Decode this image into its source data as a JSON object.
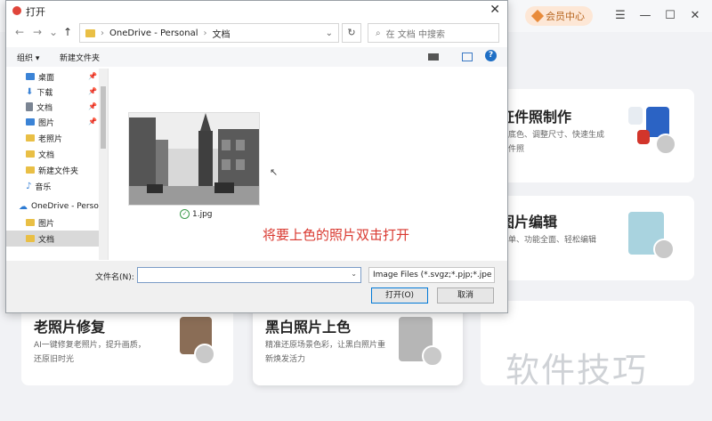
{
  "app": {
    "vip_label": "会员中心",
    "cards": [
      {
        "title": "证件照制作",
        "desc": "换底色、调整尺寸、快速生成证件照"
      },
      {
        "title": "图片编辑",
        "desc": "简单、功能全面、轻松编辑"
      },
      {
        "title": "老照片修复",
        "desc": "AI一键修复老照片，提升画质，还原旧时光"
      },
      {
        "title": "黑白照片上色",
        "desc": "精准还原场景色彩，让黑白照片重新焕发活力"
      }
    ],
    "watermark": "软件技巧"
  },
  "dialog": {
    "title": "打开",
    "address": {
      "root": "OneDrive - Personal",
      "folder": "文档"
    },
    "search_placeholder": "在 文档 中搜索",
    "toolbar": {
      "organize": "组织 ▾",
      "new_folder": "新建文件夹"
    },
    "sidebar": [
      {
        "label": "桌面",
        "icon": "desktop-icon",
        "color": "#3b83d6"
      },
      {
        "label": "下载",
        "icon": "download-icon",
        "color": "#3b83d6"
      },
      {
        "label": "文档",
        "icon": "document-icon",
        "color": "#7b8593"
      },
      {
        "label": "图片",
        "icon": "picture-icon",
        "color": "#3b83d6"
      },
      {
        "label": "老照片",
        "icon": "folder-icon",
        "color": "#e9bf45"
      },
      {
        "label": "文档",
        "icon": "folder-icon",
        "color": "#e9bf45"
      },
      {
        "label": "新建文件夹",
        "icon": "folder-icon",
        "color": "#e9bf45"
      },
      {
        "label": "音乐",
        "icon": "music-icon",
        "color": "#3b83d6"
      },
      {
        "label": "OneDrive - Perso",
        "icon": "cloud-icon",
        "color": "#2d7bd3"
      },
      {
        "label": "图片",
        "icon": "folder-icon",
        "color": "#e9bf45"
      },
      {
        "label": "文档",
        "icon": "folder-icon",
        "color": "#e9bf45"
      }
    ],
    "file": {
      "name": "1.jpg"
    },
    "annotation": "将要上色的照片双击打开",
    "filename_label": "文件名(N):",
    "filename_value": "",
    "filetype": "Image Files (*.svgz;*.pjp;*.jpe",
    "open_button": "打开(O)",
    "cancel_button": "取消"
  }
}
